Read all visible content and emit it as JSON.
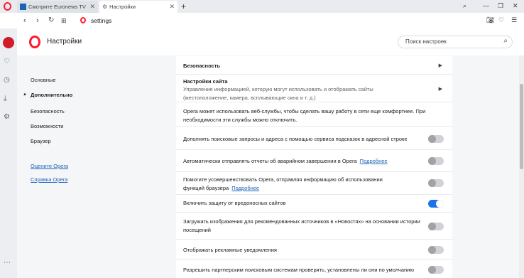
{
  "tabs": [
    {
      "label": "Смотрите Euronews TV Live"
    },
    {
      "label": "Настройки"
    }
  ],
  "address": {
    "text": "settings"
  },
  "header": {
    "title": "Настройки",
    "search_placeholder": "Поиск настроек"
  },
  "nav": {
    "basic": "Основные",
    "advanced": "Дополнительно",
    "security": "Безопасность",
    "features": "Возможности",
    "browser": "Браузер",
    "rate": "Оцените Opera",
    "help": "Справка Opera"
  },
  "content": {
    "security_heading": "Безопасность",
    "site_settings_title": "Настройки сайта",
    "site_settings_desc": "Управление информацией, которую могут использовать и отображать сайты (местоположение, камера, всплывающие окна и т. д.)",
    "services_note": "Opera может использовать веб-службы, чтобы сделать вашу работу в сети еще комфортнее. При необходимости эти службы можно отключить.",
    "more_link": "Подробнее",
    "settings": [
      {
        "label": "Дополнять поисковые запросы и адреса с помощью сервиса подсказок в адресной строке",
        "on": false
      },
      {
        "label": "Автоматически отправлять отчеты об аварийном завершении в Opera",
        "on": false
      },
      {
        "label": "Помогите усовершенствовать Opera, отправляя информацию об использовании функций браузера",
        "on": false
      },
      {
        "label": "Включить защиту от вредоносных сайтов",
        "on": true
      },
      {
        "label": "Загружать изображения для рекомендованных источников в «Новостях» на основании истории посещений",
        "on": false
      },
      {
        "label": "Отображать рекламные уведомления",
        "on": false
      },
      {
        "label": "Разрешить партнерским поисковым системам проверять, установлены ли они по умолчанию",
        "on": false
      }
    ]
  },
  "colors": {
    "accent": "#1a73e8",
    "link": "#1e62b8",
    "brand": "#ff1b2d"
  }
}
